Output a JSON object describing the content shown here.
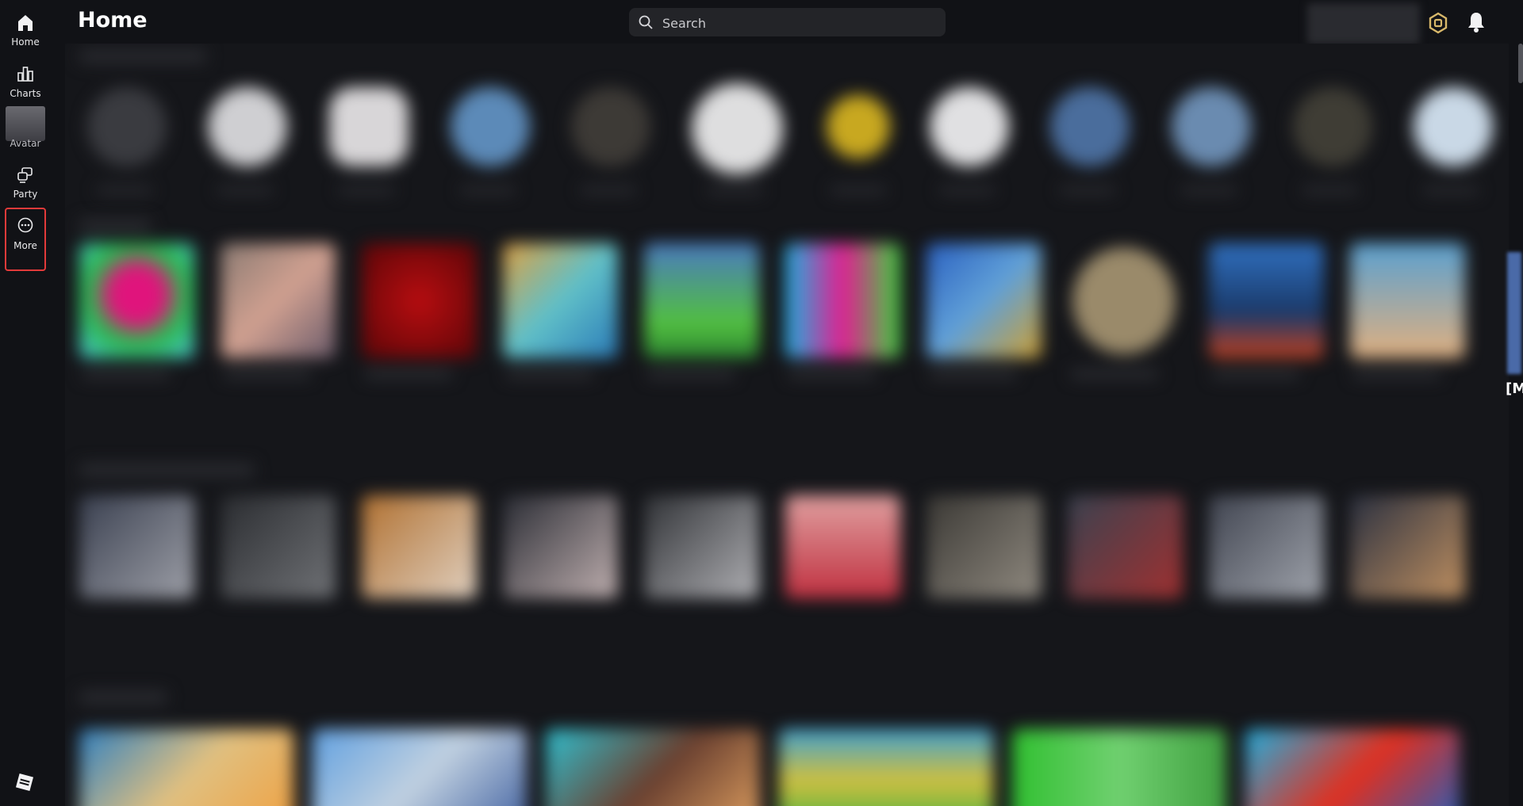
{
  "header": {
    "title": "Home",
    "search_placeholder": "Search"
  },
  "nav": {
    "items": [
      {
        "label": "Home",
        "icon": "home-icon"
      },
      {
        "label": "Charts",
        "icon": "charts-icon"
      },
      {
        "label": "Avatar",
        "icon": "avatar-thumbnail"
      },
      {
        "label": "Party",
        "icon": "party-icon"
      },
      {
        "label": "More",
        "icon": "more-icon"
      }
    ]
  },
  "colors": {
    "background": "#111216",
    "highlight": "#e23a3a",
    "search_bg": "#232428"
  },
  "edge_fragment": "[M"
}
